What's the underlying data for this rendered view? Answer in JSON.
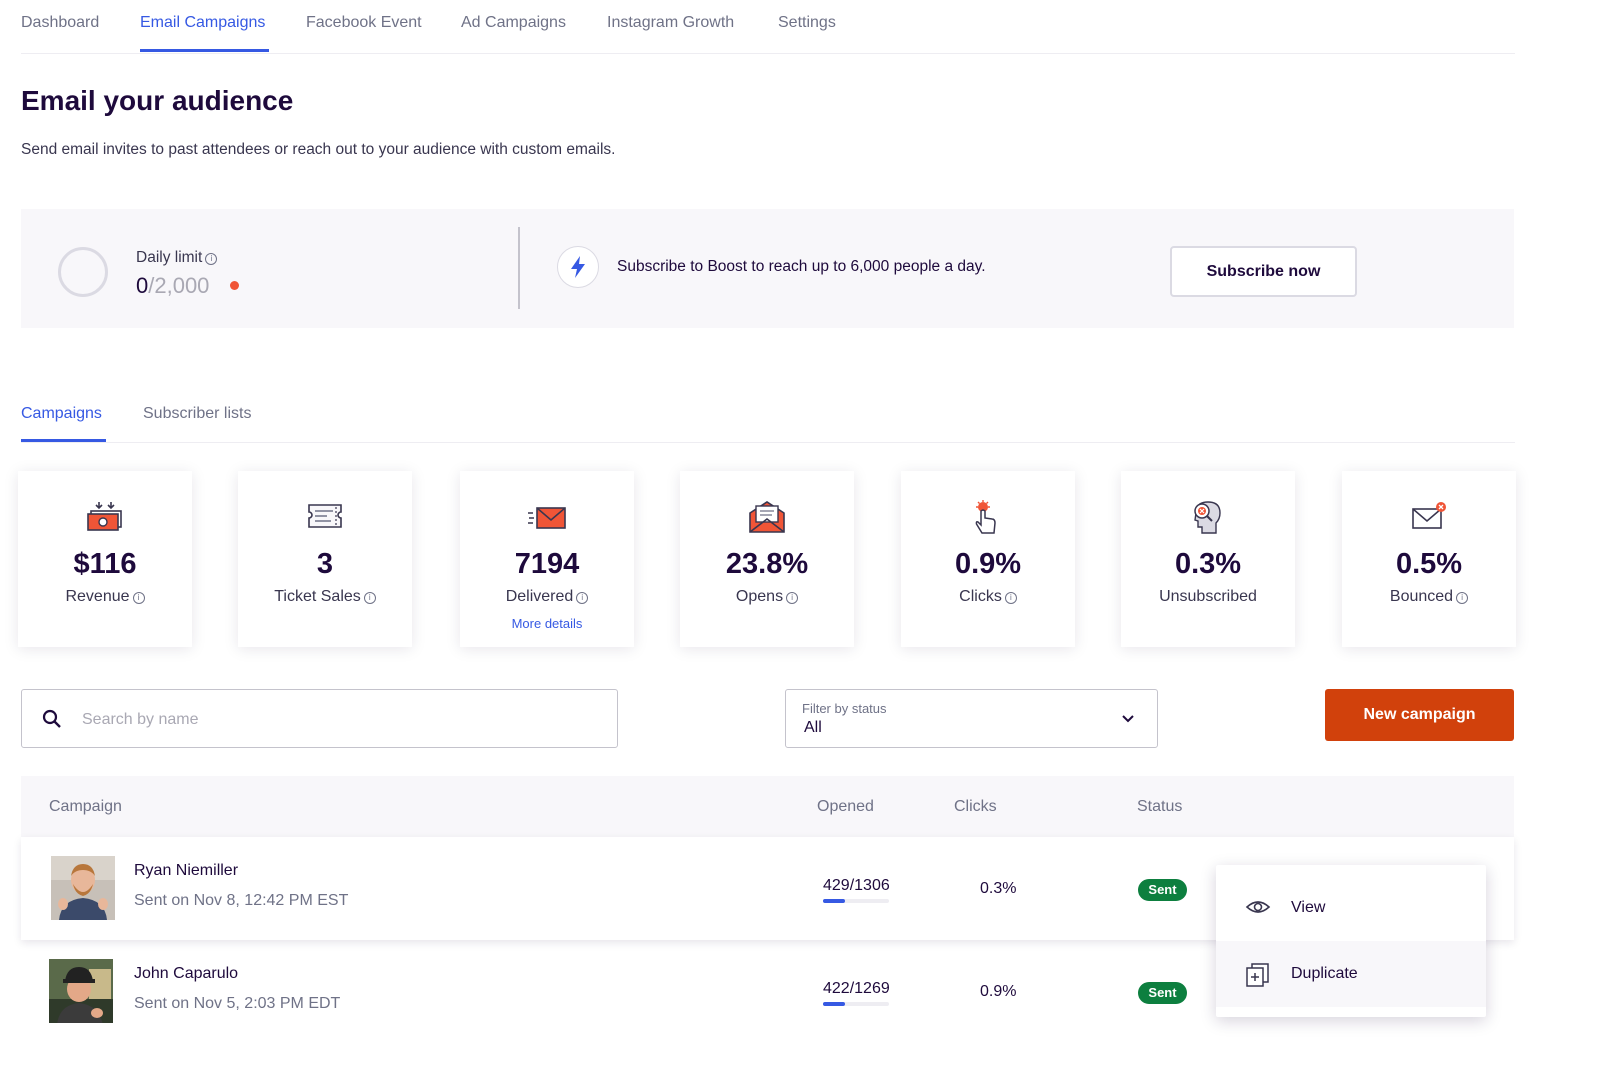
{
  "nav": {
    "tabs": [
      {
        "label": "Dashboard"
      },
      {
        "label": "Email Campaigns"
      },
      {
        "label": "Facebook Event"
      },
      {
        "label": "Ad Campaigns"
      },
      {
        "label": "Instagram Growth"
      },
      {
        "label": "Settings"
      }
    ],
    "active": "Email Campaigns"
  },
  "header": {
    "title": "Email your audience",
    "subtitle": "Send email invites to past attendees or reach out to your audience with custom emails."
  },
  "limit": {
    "label": "Daily limit",
    "used": "0",
    "max": "/2,000",
    "boost_text": "Subscribe to Boost to reach up to 6,000 people a day.",
    "subscribe_label": "Subscribe now",
    "icon": "lightning-bolt-icon"
  },
  "subtabs": {
    "tabs": [
      {
        "label": "Campaigns"
      },
      {
        "label": "Subscriber lists"
      }
    ],
    "active": "Campaigns"
  },
  "stats": [
    {
      "value": "$116",
      "label": "Revenue",
      "icon": "money-icon"
    },
    {
      "value": "3",
      "label": "Ticket Sales",
      "icon": "ticket-icon"
    },
    {
      "value": "7194",
      "label": "Delivered",
      "icon": "envelope-send-icon",
      "link": "More details"
    },
    {
      "value": "23.8%",
      "label": "Opens",
      "icon": "open-envelope-icon"
    },
    {
      "value": "0.9%",
      "label": "Clicks",
      "icon": "click-hand-icon"
    },
    {
      "value": "0.3%",
      "label": "Unsubscribed",
      "icon": "unsubscribe-head-icon"
    },
    {
      "value": "0.5%",
      "label": "Bounced",
      "icon": "bounced-envelope-icon"
    }
  ],
  "controls": {
    "search_placeholder": "Search by name",
    "filter_label": "Filter by status",
    "filter_value": "All",
    "new_campaign_label": "New campaign"
  },
  "table": {
    "headers": {
      "campaign": "Campaign",
      "opened": "Opened",
      "clicks": "Clicks",
      "status": "Status"
    },
    "rows": [
      {
        "name": "Ryan Niemiller",
        "sent": "Sent on Nov 8, 12:42 PM EST",
        "opened": "429/1306",
        "opened_fraction": 0.33,
        "clicks": "0.3%",
        "status": "Sent"
      },
      {
        "name": "John Caparulo",
        "sent": "Sent on Nov 5, 2:03 PM EDT",
        "opened": "422/1269",
        "opened_fraction": 0.33,
        "clicks": "0.9%",
        "status": "Sent"
      }
    ]
  },
  "menu": {
    "view_label": "View",
    "duplicate_label": "Duplicate"
  },
  "colors": {
    "accent": "#3659e3",
    "primary_button": "#d1410c",
    "status_sent": "#0d7f3f",
    "limit_dot": "#f05537"
  }
}
